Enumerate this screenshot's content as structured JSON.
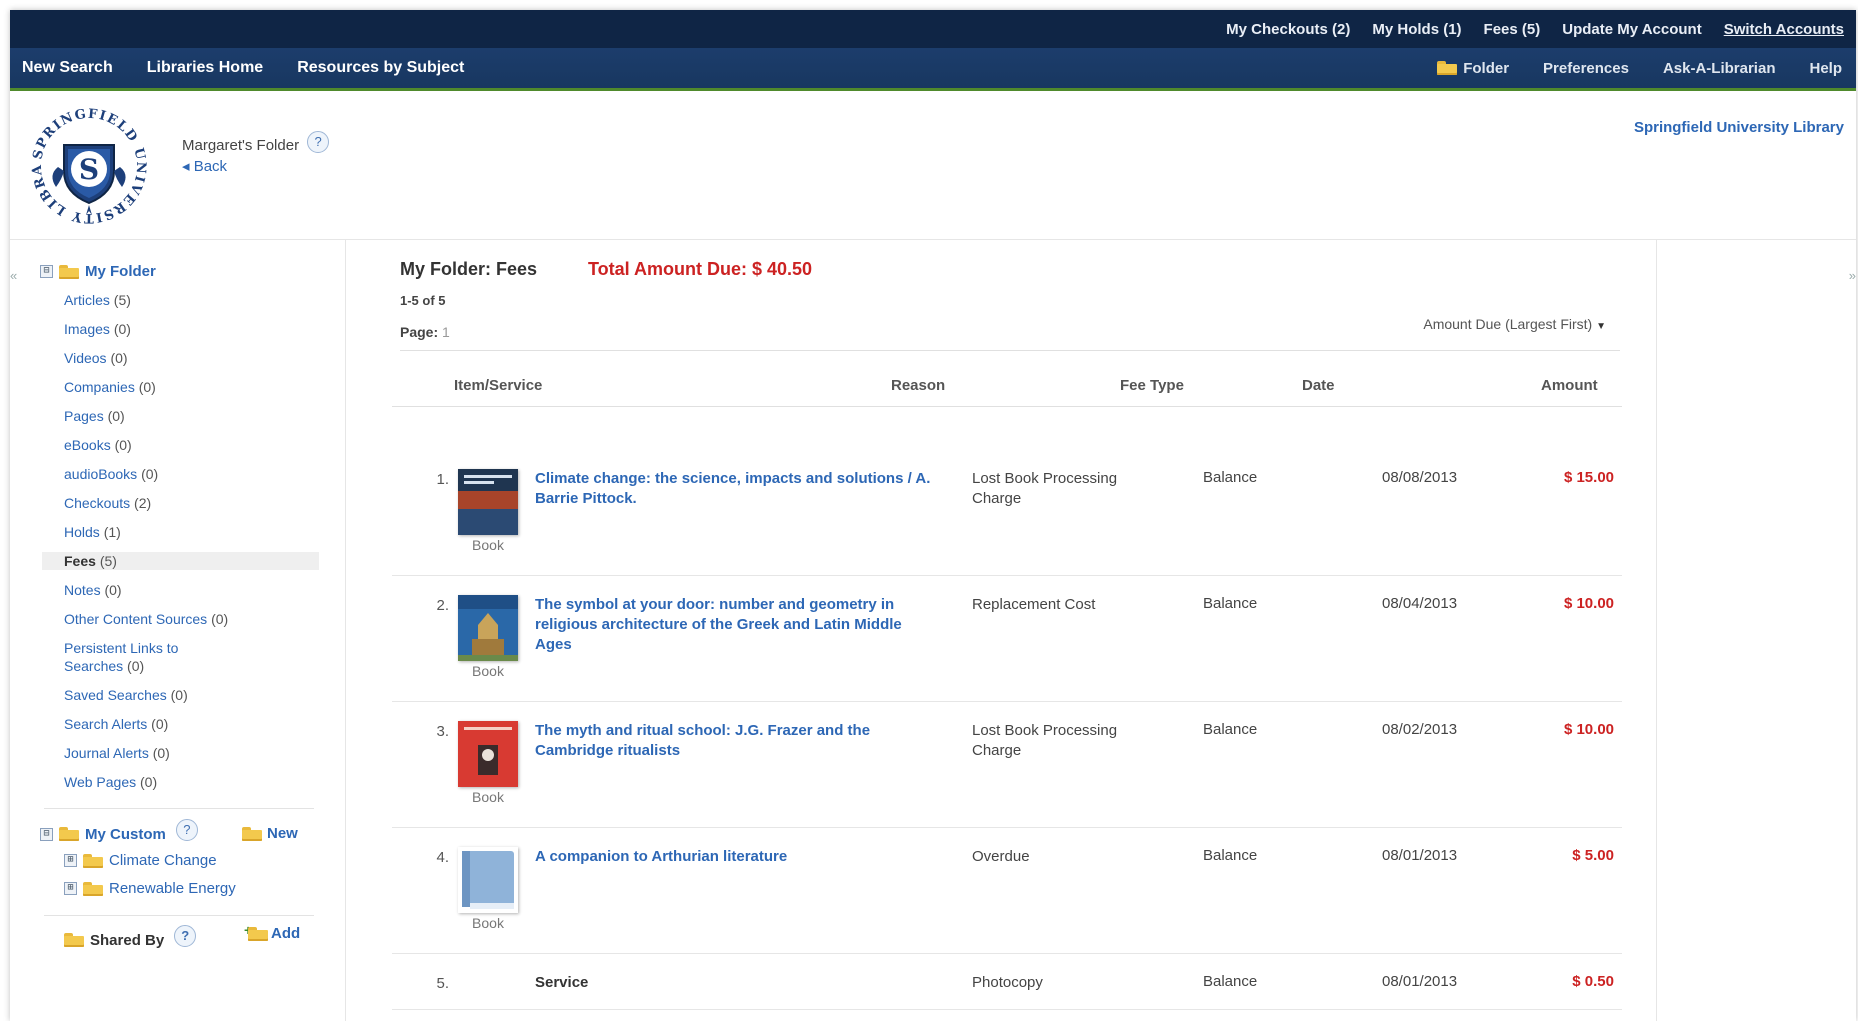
{
  "top_bar": {
    "links": [
      "My Checkouts (2)",
      "My Holds (1)",
      "Fees (5)",
      "Update My Account",
      "Switch Accounts"
    ]
  },
  "nav": {
    "left": [
      "New Search",
      "Libraries Home",
      "Resources by Subject"
    ],
    "folder": "Folder",
    "preferences": "Preferences",
    "ask": "Ask-A-Librarian",
    "help": "Help"
  },
  "header": {
    "folder_title": "Margaret's Folder",
    "help_mark": "?",
    "back": "◂ Back",
    "library_link": "Springfield University Library",
    "logo_text": "SPRINGFIELD UNIVERSITY LIBRARY",
    "logo_letter": "S"
  },
  "sidebar": {
    "collapse_left": "«",
    "collapse_right": "»",
    "my_folder": "My Folder",
    "items": [
      {
        "label": "Articles",
        "count": "(5)"
      },
      {
        "label": "Images",
        "count": "(0)"
      },
      {
        "label": "Videos",
        "count": "(0)"
      },
      {
        "label": "Companies",
        "count": "(0)"
      },
      {
        "label": "Pages",
        "count": "(0)"
      },
      {
        "label": "eBooks",
        "count": "(0)"
      },
      {
        "label": "audioBooks",
        "count": "(0)"
      },
      {
        "label": "Checkouts",
        "count": "(2)"
      },
      {
        "label": "Holds",
        "count": "(1)"
      },
      {
        "label": "Fees",
        "count": "(5)"
      },
      {
        "label": "Notes",
        "count": "(0)"
      },
      {
        "label": "Other Content Sources",
        "count": "(0)"
      },
      {
        "label": "Persistent Links to Searches",
        "count": "(0)"
      },
      {
        "label": "Saved Searches",
        "count": "(0)"
      },
      {
        "label": "Search Alerts",
        "count": "(0)"
      },
      {
        "label": "Journal Alerts",
        "count": "(0)"
      },
      {
        "label": "Web Pages",
        "count": "(0)"
      }
    ],
    "my_custom": "My Custom",
    "new": "New",
    "custom_folders": [
      "Climate Change",
      "Renewable Energy"
    ],
    "shared_by": "Shared By",
    "add": "Add",
    "expander_minus": "⊟",
    "expander_plus": "⊞"
  },
  "main": {
    "heading": "My Folder: Fees",
    "total_due": "Total Amount Due: $ 40.50",
    "range": "1-5 of 5",
    "page_label": "Page:",
    "page_num": "1",
    "sort": "Amount Due (Largest First)",
    "columns": {
      "item": "Item/Service",
      "reason": "Reason",
      "fee_type": "Fee Type",
      "date": "Date",
      "amount": "Amount"
    },
    "rows": [
      {
        "num": "1.",
        "title": "Climate change: the science, impacts and solutions / A. Barrie Pittock.",
        "format": "Book",
        "reason": "Lost Book Processing Charge",
        "fee_type": "Balance",
        "date": "08/08/2013",
        "amount": "$ 15.00",
        "cover": "climate"
      },
      {
        "num": "2.",
        "title": "The symbol at your door: number and geometry in religious architecture of the Greek and Latin Middle Ages",
        "format": "Book",
        "reason": "Replacement Cost",
        "fee_type": "Balance",
        "date": "08/04/2013",
        "amount": "$ 10.00",
        "cover": "symbol"
      },
      {
        "num": "3.",
        "title": "The myth and ritual school: J.G. Frazer and the Cambridge ritualists",
        "format": "Book",
        "reason": "Lost Book Processing Charge",
        "fee_type": "Balance",
        "date": "08/02/2013",
        "amount": "$ 10.00",
        "cover": "myth"
      },
      {
        "num": "4.",
        "title": "A companion to Arthurian literature",
        "format": "Book",
        "reason": "Overdue",
        "fee_type": "Balance",
        "date": "08/01/2013",
        "amount": "$ 5.00",
        "cover": "generic"
      },
      {
        "num": "5.",
        "title": "Service",
        "format": "",
        "reason": "Photocopy",
        "fee_type": "Balance",
        "date": "08/01/2013",
        "amount": "$ 0.50",
        "cover": "none"
      }
    ]
  }
}
